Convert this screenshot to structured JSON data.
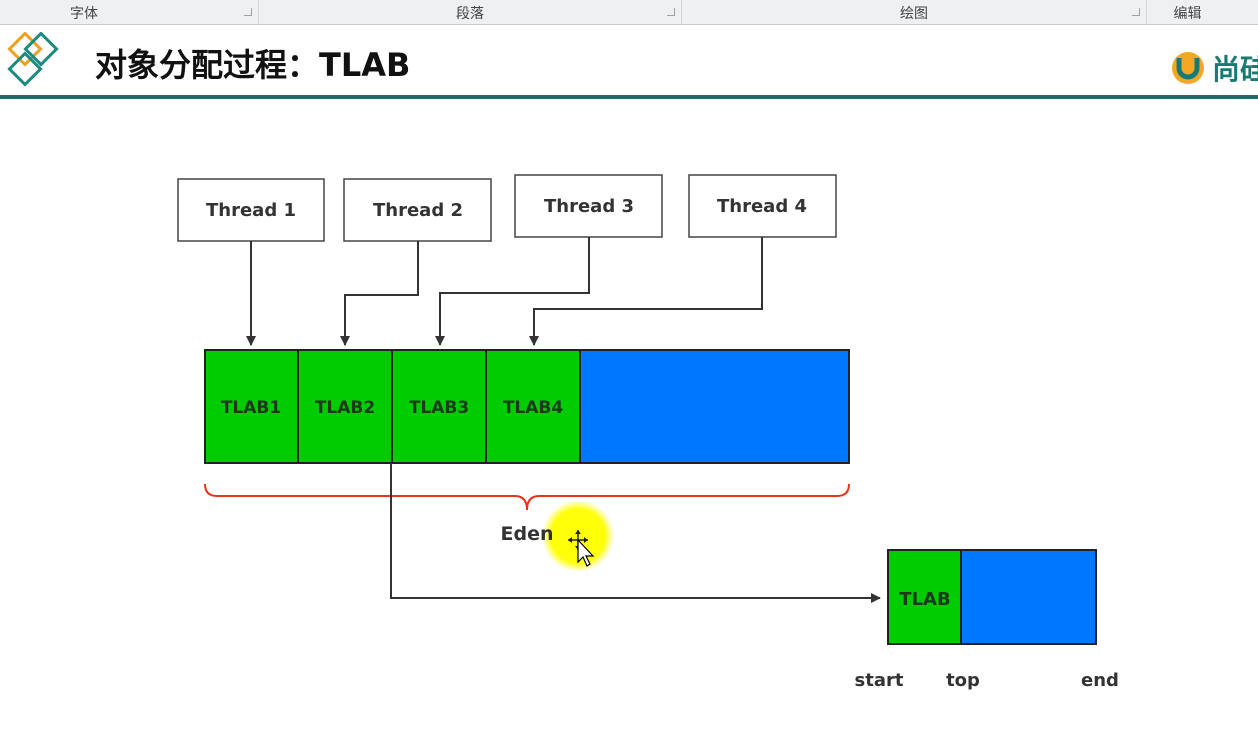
{
  "ribbon": {
    "groups": [
      {
        "label": "字体"
      },
      {
        "label": "段落"
      },
      {
        "label": "绘图"
      },
      {
        "label": "编辑"
      }
    ]
  },
  "slide": {
    "title": "对象分配过程：TLAB",
    "brand": "尚硅"
  },
  "diagram": {
    "threads": [
      "Thread 1",
      "Thread 2",
      "Thread 3",
      "Thread 4"
    ],
    "tlabs": [
      "TLAB1",
      "TLAB2",
      "TLAB3",
      "TLAB4"
    ],
    "eden_label": "Eden",
    "detail_tlab_label": "TLAB",
    "pointer_labels": {
      "start": "start",
      "top": "top",
      "end": "end"
    },
    "colors": {
      "tlab": "#00cc00",
      "free": "#0077ff",
      "brace": "#e8331c",
      "highlight": "#ffff00",
      "accent": "#1d6b66"
    }
  }
}
